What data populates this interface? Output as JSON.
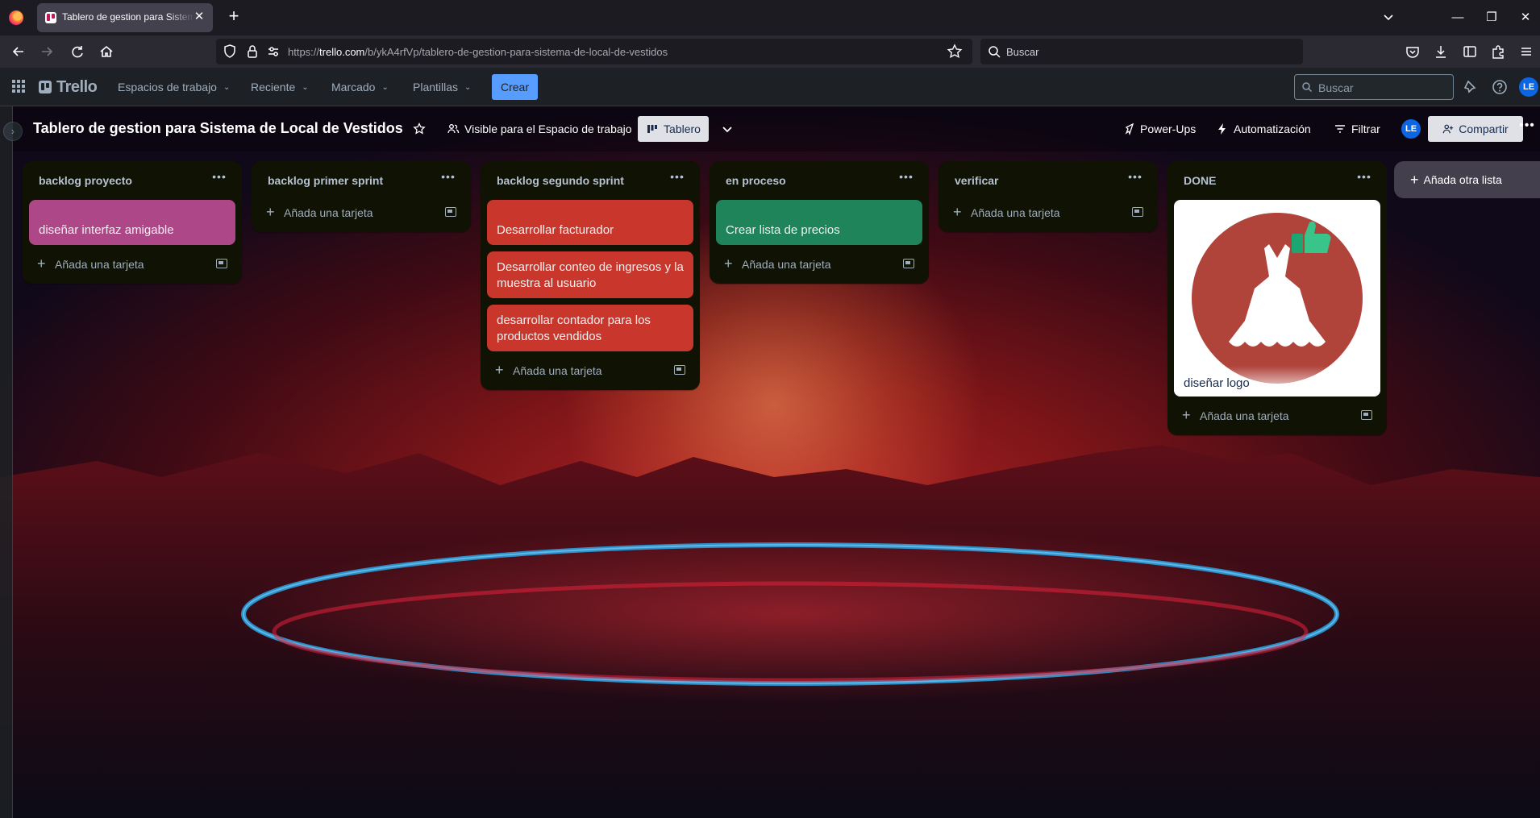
{
  "browser": {
    "tab_title": "Tablero de gestion para Sistema de Local de Vestidos | Trello",
    "url_prefix": "https://",
    "url_host": "trello.com",
    "url_path": "/b/ykA4rfVp/tablero-de-gestion-para-sistema-de-local-de-vestidos",
    "search_placeholder": "Buscar"
  },
  "trello_header": {
    "logo": "Trello",
    "menus": [
      "Espacios de trabajo",
      "Reciente",
      "Marcado",
      "Plantillas"
    ],
    "create_label": "Crear",
    "search_placeholder": "Buscar",
    "avatar_initials": "LE"
  },
  "board_bar": {
    "title": "Tablero de gestion para Sistema de Local de Vestidos",
    "visibility": "Visible para el Espacio de trabajo",
    "view": "Tablero",
    "power_ups": "Power-Ups",
    "automation": "Automatización",
    "filter": "Filtrar",
    "member_initials": "LE",
    "share": "Compartir"
  },
  "add_card_label": "Añada una tarjeta",
  "add_list_label": "Añada otra lista",
  "lists": [
    {
      "title": "backlog proyecto",
      "cards": [
        {
          "text": "diseñar interfaz amigable",
          "color": "#ae4787"
        }
      ]
    },
    {
      "title": "backlog primer sprint",
      "cards": []
    },
    {
      "title": "backlog segundo sprint",
      "cards": [
        {
          "text": "Desarrollar facturador",
          "color": "#c9372c"
        },
        {
          "text": "Desarrollar conteo de ingresos y la muestra al usuario",
          "color": "#c9372c"
        },
        {
          "text": "desarrollar contador para los productos vendidos",
          "color": "#c9372c"
        }
      ]
    },
    {
      "title": "en proceso",
      "cards": [
        {
          "text": "Crear lista de precios",
          "color": "#1f845a"
        }
      ]
    },
    {
      "title": "verificar",
      "cards": []
    },
    {
      "title": "DONE",
      "cards": [
        {
          "text": "diseñar logo",
          "cover": "dress-logo"
        }
      ]
    }
  ]
}
